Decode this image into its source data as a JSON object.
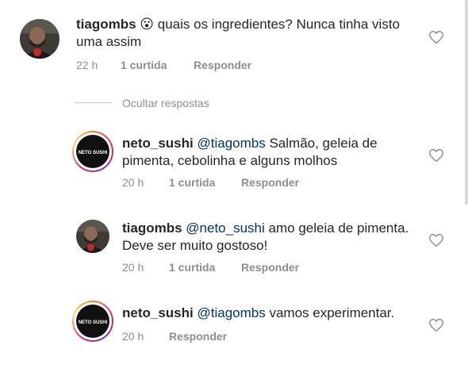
{
  "comments": [
    {
      "username": "tiagombs",
      "emoji": "😮",
      "text": "quais os ingredientes? Nunca tinha visto uma assim",
      "time": "22 h",
      "likes": "1 curtida",
      "reply": "Responder"
    },
    {
      "username": "neto_sushi",
      "mention": "@tiagombs",
      "text": "Salmão, geleia de pimenta, cebolinha e alguns molhos",
      "time": "20 h",
      "likes": "1 curtida",
      "reply": "Responder",
      "avatar_text": "NETO SUSHI"
    },
    {
      "username": "tiagombs",
      "mention": "@neto_sushi",
      "text": "amo geleia de pimenta. Deve ser muito gostoso!",
      "time": "20 h",
      "likes": "1 curtida",
      "reply": "Responder"
    },
    {
      "username": "neto_sushi",
      "mention": "@tiagombs",
      "text": "vamos experimentar.",
      "time": "20 h",
      "reply": "Responder",
      "avatar_text": "NETO SUSHI"
    }
  ],
  "hide_replies_label": "Ocultar respostas",
  "colors": {
    "text": "#262626",
    "meta": "#8e8e8e",
    "mention": "#003569",
    "neto_red": "#d32f2f"
  }
}
